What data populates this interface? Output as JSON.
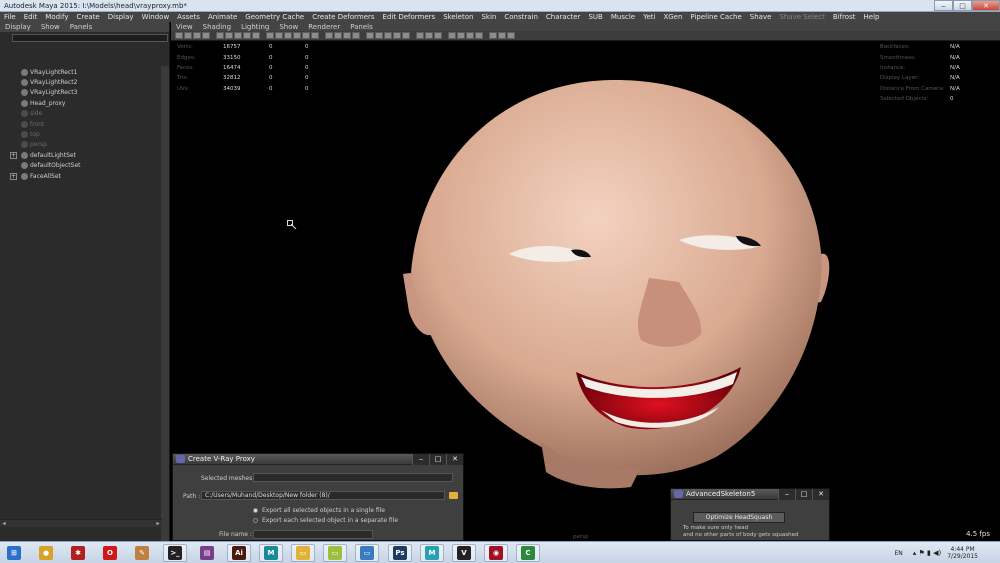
{
  "window": {
    "title": "Autodesk Maya 2015: I:\\Models\\head\\vrayproxy.mb*",
    "min": "‒",
    "max": "□",
    "close": "✕"
  },
  "main_menu": [
    "File",
    "Edit",
    "Modify",
    "Create",
    "Display",
    "Window",
    "Assets",
    "Animate",
    "Geometry Cache",
    "Create Deformers",
    "Edit Deformers",
    "Skeleton",
    "Skin",
    "Constrain",
    "Character",
    "SUB",
    "Muscle",
    "Yeti",
    "XGen",
    "Pipeline Cache",
    "Shave",
    "Shave Select",
    "Bifrost",
    "Help"
  ],
  "outliner": {
    "menu": [
      "Display",
      "Show",
      "Panels"
    ],
    "items": [
      {
        "label": "VRayLightRect1",
        "dim": false,
        "expandable": false
      },
      {
        "label": "VRayLightRect2",
        "dim": false,
        "expandable": false
      },
      {
        "label": "VRayLightRect3",
        "dim": false,
        "expandable": false
      },
      {
        "label": "Head_proxy",
        "dim": false,
        "expandable": false
      },
      {
        "label": "side",
        "dim": true,
        "expandable": false
      },
      {
        "label": "front",
        "dim": true,
        "expandable": false
      },
      {
        "label": "top",
        "dim": true,
        "expandable": false
      },
      {
        "label": "persp",
        "dim": true,
        "expandable": false
      },
      {
        "label": "defaultLightSet",
        "dim": false,
        "expandable": true
      },
      {
        "label": "defaultObjectSet",
        "dim": false,
        "expandable": false
      },
      {
        "label": "FaceAllSet",
        "dim": false,
        "expandable": true
      }
    ],
    "scroll_left": "◂",
    "scroll_right": "▸",
    "expand_glyph": "+"
  },
  "panel_menu": [
    "View",
    "Shading",
    "Lighting",
    "Show",
    "Renderer",
    "Panels"
  ],
  "hud_left": [
    {
      "label": "Verts:",
      "a": "16757",
      "b": "0",
      "c": "0"
    },
    {
      "label": "Edges:",
      "a": "33150",
      "b": "0",
      "c": "0"
    },
    {
      "label": "Faces:",
      "a": "16474",
      "b": "0",
      "c": "0"
    },
    {
      "label": "Tris:",
      "a": "32812",
      "b": "0",
      "c": "0"
    },
    {
      "label": "UVs:",
      "a": "34039",
      "b": "0",
      "c": "0"
    }
  ],
  "hud_right": [
    {
      "label": "Backfaces:",
      "value": "N/A"
    },
    {
      "label": "Smoothness:",
      "value": "N/A"
    },
    {
      "label": "Instance:",
      "value": "N/A"
    },
    {
      "label": "Display Layer:",
      "value": "N/A"
    },
    {
      "label": "Distance From Camera:",
      "value": "N/A"
    },
    {
      "label": "Selected Objects:",
      "value": "0"
    }
  ],
  "viewport": {
    "fps": "4.5 fps",
    "camera": "persp"
  },
  "vray_proxy_dialog": {
    "title": "Create V-Ray Proxy",
    "selected_meshes_label": "Selected meshes :",
    "selected_meshes_value": "",
    "path_label": "Path :",
    "path_value": "C:/Users/Muhand/Desktop/New folder (8)/",
    "export_single": "Export all selected objects in a single file",
    "export_separate": "Export each selected object in a separate file",
    "file_name_label": "File name :",
    "file_name_value": ""
  },
  "skeleton_dialog": {
    "title": "AdvancedSkeleton5",
    "button": "Optimize HeadSquash",
    "note_line1": "To make sure only head",
    "note_line2": "and no other parts of body gets squashed"
  },
  "taskbar": {
    "lang": "EN",
    "time": "4:44 PM",
    "date": "7/29/2015",
    "apps": [
      {
        "name": "start",
        "glyph": "⊞",
        "color": "#2a6fc9"
      },
      {
        "name": "chrome",
        "glyph": "●",
        "color": "#d9a226"
      },
      {
        "name": "app-red",
        "glyph": "✱",
        "color": "#b02020"
      },
      {
        "name": "opera",
        "glyph": "O",
        "color": "#d01818"
      },
      {
        "name": "paint",
        "glyph": "✎",
        "color": "#c08040"
      },
      {
        "name": "cmd",
        "glyph": ">_",
        "color": "#222222"
      },
      {
        "name": "winrar",
        "glyph": "▤",
        "color": "#7a3d8c"
      },
      {
        "name": "illustrator",
        "glyph": "Ai",
        "color": "#4a1a10"
      },
      {
        "name": "maya",
        "glyph": "M",
        "color": "#1a8a9a"
      },
      {
        "name": "explorer",
        "glyph": "▭",
        "color": "#e0b23a"
      },
      {
        "name": "notes",
        "glyph": "▭",
        "color": "#9ac040"
      },
      {
        "name": "screen",
        "glyph": "▭",
        "color": "#3a7ac0"
      },
      {
        "name": "photoshop",
        "glyph": "Ps",
        "color": "#1f3c62"
      },
      {
        "name": "maya2",
        "glyph": "M",
        "color": "#2aa0b0"
      },
      {
        "name": "vray",
        "glyph": "V",
        "color": "#222222"
      },
      {
        "name": "davinci",
        "glyph": "◉",
        "color": "#a01020"
      },
      {
        "name": "camtasia",
        "glyph": "C",
        "color": "#2a8a3a"
      }
    ]
  }
}
